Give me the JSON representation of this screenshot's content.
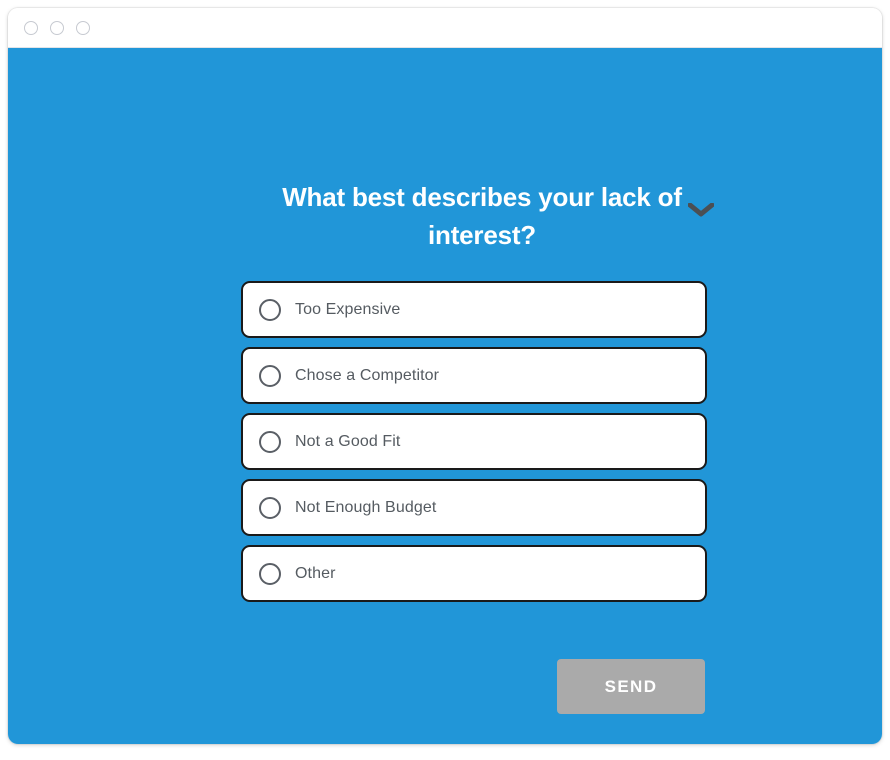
{
  "window": {
    "traffic_lights": [
      "close-dot",
      "minimize-dot",
      "maximize-dot"
    ],
    "background_color": "#2196d8",
    "card_border_color": "#1a1a1a"
  },
  "survey": {
    "collapse_icon": "chevron-down-icon",
    "question": "What best describes your lack of interest?",
    "options": [
      {
        "label": "Too Expensive",
        "selected": false
      },
      {
        "label": "Chose a Competitor",
        "selected": false
      },
      {
        "label": "Not a Good Fit",
        "selected": false
      },
      {
        "label": "Not Enough Budget",
        "selected": false
      },
      {
        "label": "Other",
        "selected": false
      }
    ],
    "submit": {
      "label": "SEND",
      "enabled": false,
      "color": "#aaaaaa"
    }
  }
}
